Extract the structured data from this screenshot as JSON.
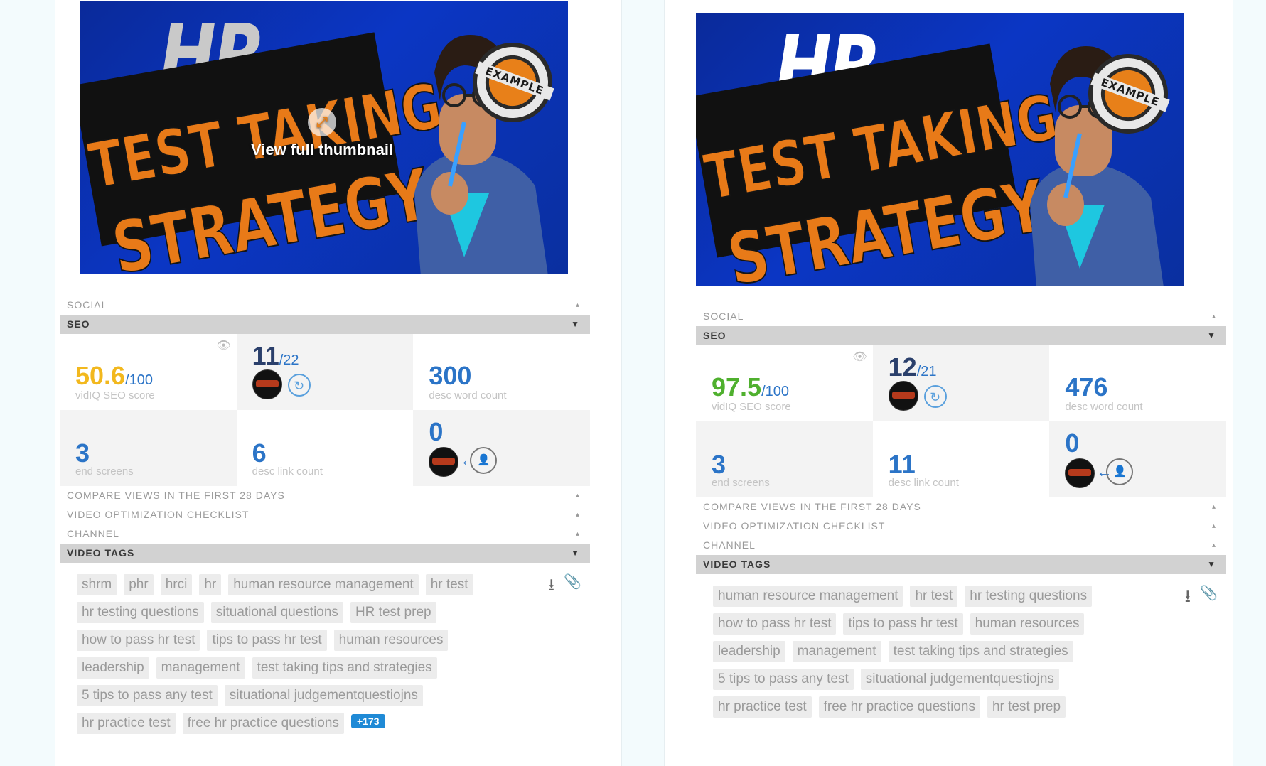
{
  "panels": [
    {
      "thumbnail": {
        "title_hr": "HR",
        "line1": "TEST TAKING",
        "line2": "STRATEGY",
        "badge": "EXAMPLE",
        "overlay_label": "View full thumbnail"
      },
      "sections": {
        "social": "SOCIAL",
        "seo": "SEO",
        "compare": "COMPARE VIEWS IN THE FIRST 28 DAYS",
        "checklist": "VIDEO OPTIMIZATION CHECKLIST",
        "channel": "CHANNEL",
        "tags": "VIDEO TAGS"
      },
      "stats": {
        "seo_score": "50.6",
        "seo_score_max": "/100",
        "seo_score_label": "vidIQ SEO score",
        "tag_count": "11",
        "tag_count_max": "/22",
        "desc_word_count": "300",
        "desc_word_count_label": "desc word count",
        "end_screens": "3",
        "end_screens_label": "end screens",
        "desc_link_count": "6",
        "desc_link_count_label": "desc link count",
        "links_zero": "0"
      },
      "tags": [
        "shrm",
        "phr",
        "hrci",
        "hr",
        "human resource management",
        "hr test",
        "hr testing questions",
        "situational questions",
        "HR test prep",
        "how to pass hr test",
        "tips to pass hr test",
        "human resources",
        "leadership",
        "management",
        "test taking tips and strategies",
        "5 tips to pass any test",
        "situational judgementquestiojns",
        "hr practice test",
        "free hr practice questions"
      ],
      "tags_char_count": "+173"
    },
    {
      "thumbnail": {
        "title_hr": "HR",
        "line1": "TEST TAKING",
        "line2": "STRATEGY",
        "badge": "EXAMPLE"
      },
      "sections": {
        "social": "SOCIAL",
        "seo": "SEO",
        "compare": "COMPARE VIEWS IN THE FIRST 28 DAYS",
        "checklist": "VIDEO OPTIMIZATION CHECKLIST",
        "channel": "CHANNEL",
        "tags": "VIDEO TAGS"
      },
      "stats": {
        "seo_score": "97.5",
        "seo_score_max": "/100",
        "seo_score_label": "vidIQ SEO score",
        "tag_count": "12",
        "tag_count_max": "/21",
        "desc_word_count": "476",
        "desc_word_count_label": "desc word count",
        "end_screens": "3",
        "end_screens_label": "end screens",
        "desc_link_count": "11",
        "desc_link_count_label": "desc link count",
        "links_zero": "0"
      },
      "tags": [
        "human resource management",
        "hr test",
        "hr testing questions",
        "how to pass hr test",
        "tips to pass hr test",
        "human resources",
        "leadership",
        "management",
        "test taking tips and strategies",
        "5 tips to pass any test",
        "situational judgementquestiojns",
        "hr practice test",
        "free hr practice questions",
        "hr test prep"
      ]
    }
  ],
  "colors": {
    "score_low": "#f2b81e",
    "score_high": "#4fb02e",
    "accent_blue": "#2b74c7",
    "tag_bg": "#ececec",
    "section_open_bg": "#d2d2d2"
  },
  "icons": {
    "eye": "eye-icon",
    "download": "download-icon",
    "clip": "paperclip-icon",
    "refresh": "refresh-icon",
    "end_screen_link": "end-screen-link-icon"
  }
}
